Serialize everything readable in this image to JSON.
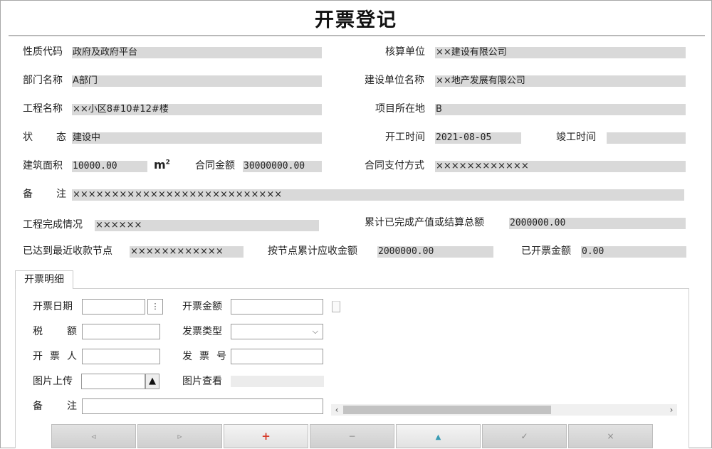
{
  "page": {
    "title": "开票登记"
  },
  "form": {
    "nature_code": {
      "label": "性质代码",
      "value": "政府及政府平台"
    },
    "accounting_unit": {
      "label": "核算单位",
      "value": "××建设有限公司"
    },
    "dept_name": {
      "label": "部门名称",
      "value": "A部门"
    },
    "construction_unit": {
      "label": "建设单位名称",
      "value": "××地产发展有限公司"
    },
    "project_name": {
      "label": "工程名称",
      "value": "××小区8#10#12#楼"
    },
    "project_location": {
      "label": "项目所在地",
      "value": "B"
    },
    "status": {
      "label_a": "状",
      "label_b": "态",
      "value": "建设中"
    },
    "start_time": {
      "label": "开工时间",
      "value": "2021-08-05"
    },
    "completion_time": {
      "label": "竣工时间",
      "value": ""
    },
    "building_area": {
      "label": "建筑面积",
      "value": "10000.00",
      "unit": "m",
      "unit_sup": "2"
    },
    "contract_amount": {
      "label": "合同金额",
      "value": "30000000.00"
    },
    "contract_payment": {
      "label": "合同支付方式",
      "value": "××××××××××××"
    },
    "remarks": {
      "label_a": "备",
      "label_b": "注",
      "value": "×××××××××××××××××××××××××××"
    },
    "completion_status": {
      "label": "工程完成情况",
      "value": "××××××"
    },
    "cumulative_output": {
      "label": "累计已完成产值或结算总额",
      "value": "2000000.00"
    },
    "recent_node": {
      "label": "已达到最近收款节点",
      "value": "××××××××××××"
    },
    "node_receivable": {
      "label": "按节点累计应收金额",
      "value": "2000000.00"
    },
    "invoiced_amount": {
      "label": "已开票金额",
      "value": "0.00"
    }
  },
  "tabs": [
    {
      "label": "开票明细",
      "active": true
    }
  ],
  "detail": {
    "invoice_date": {
      "label": "开票日期",
      "value": "",
      "btn": "⋮"
    },
    "invoice_amount": {
      "label": "开票金额",
      "value": ""
    },
    "tax_amount": {
      "label_a": "税",
      "label_b": "额",
      "value": ""
    },
    "invoice_type": {
      "label": "发票类型",
      "value": ""
    },
    "issuer": {
      "label_a": "开",
      "label_b": "票",
      "label_c": "人",
      "value": ""
    },
    "invoice_no": {
      "label_a": "发",
      "label_b": "票",
      "label_c": "号",
      "value": ""
    },
    "image_upload": {
      "label": "图片上传",
      "value": ""
    },
    "image_view": {
      "label": "图片查看",
      "value": ""
    },
    "detail_remarks": {
      "label_a": "备",
      "label_b": "注",
      "value": ""
    }
  },
  "toolbar": {
    "first": "◃",
    "next": "▹",
    "add": "+",
    "delete": "−",
    "edit": "▲",
    "save": "✓",
    "cancel": "×"
  },
  "scroll": {
    "left": "‹",
    "right": "›"
  },
  "colors": {
    "add_red": "#d63b2a",
    "edit_teal": "#3a9cb4",
    "field_gray": "#d9d9d9"
  }
}
